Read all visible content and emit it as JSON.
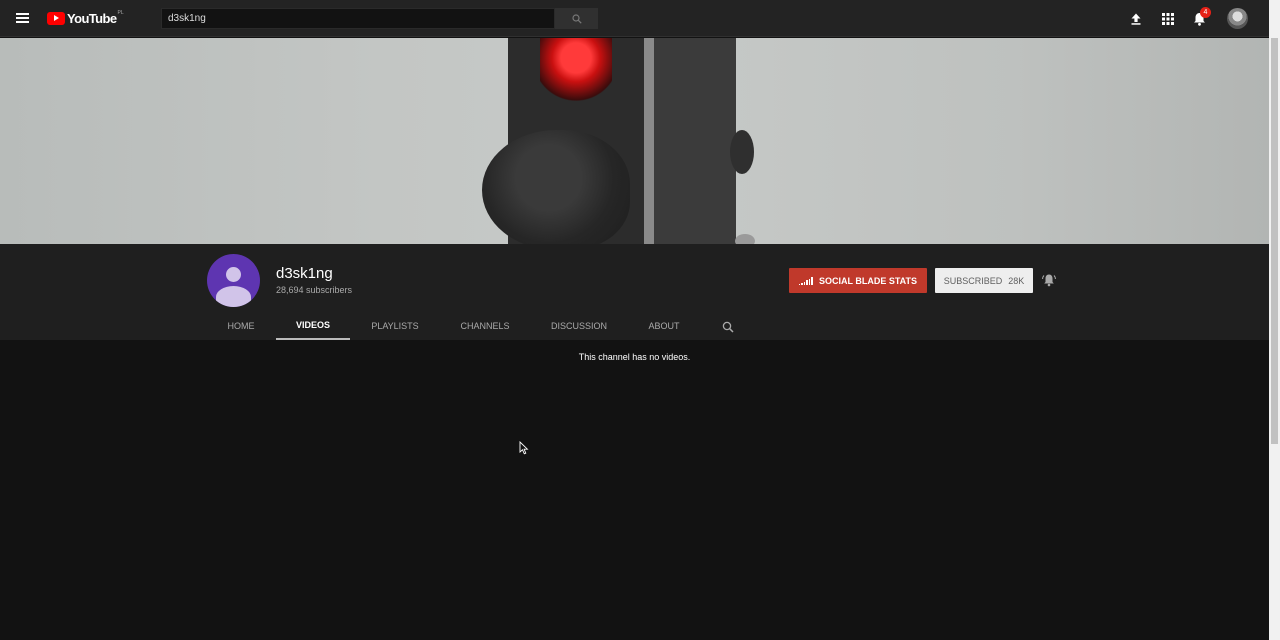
{
  "masthead": {
    "logo_text": "YouTube",
    "logo_region": "PL",
    "search": {
      "value": "d3sk1ng",
      "placeholder": "Search"
    },
    "icons": [
      "menu-icon",
      "search-icon",
      "upload-icon",
      "apps-grid-icon",
      "notifications-bell-icon",
      "account-avatar"
    ],
    "notification_count": "4"
  },
  "channel": {
    "name": "d3sk1ng",
    "subscribers": "28,694 subscribers",
    "social_blade_label": "SOCIAL BLADE STATS",
    "subscribed_label": "SUBSCRIBED",
    "subscribed_count": "28K",
    "avatar_color": "#5e35b1",
    "social_blade_color": "#c0392b"
  },
  "tabs": [
    {
      "label": "HOME",
      "active": false
    },
    {
      "label": "VIDEOS",
      "active": true
    },
    {
      "label": "PLAYLISTS",
      "active": false
    },
    {
      "label": "CHANNELS",
      "active": false
    },
    {
      "label": "DISCUSSION",
      "active": false
    },
    {
      "label": "ABOUT",
      "active": false
    }
  ],
  "content": {
    "empty_message": "This channel has no videos."
  }
}
